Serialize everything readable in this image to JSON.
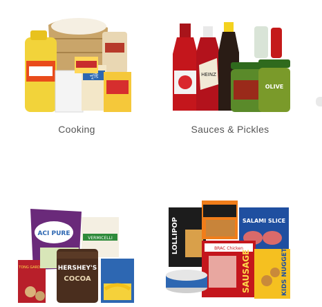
{
  "categories": [
    {
      "label": "Cooking",
      "image_icon": "cooking-products-image"
    },
    {
      "label": "Sauces & Pickles",
      "image_icon": "sauces-pickles-image"
    },
    {
      "label": "",
      "image_icon": "snacks-baking-image"
    },
    {
      "label": "",
      "image_icon": "frozen-foods-image"
    }
  ],
  "product_text": {
    "pusti": "পুষ্টি",
    "heinz": "HEINZ",
    "olive": "OLIVE",
    "aci_pure": "ACI PURE",
    "vermicelli": "VERMICELLI",
    "tong_garden": "TONG GARDEN",
    "hersheys": "HERSHEY'S",
    "cocoa": "COCOA",
    "lollipop": "LOLLIPOP",
    "brac_chicken": "BRAC Chicken",
    "salami": "SALAMI SLICE",
    "sausage": "SAUSAGE",
    "nuggets": "KIDS NUGGETS"
  },
  "colors": {
    "label_text": "#555555",
    "oil_yellow": "#f2d33a",
    "sauce_red": "#c4161c",
    "pickle_green": "#3d7a1e",
    "chips_purple": "#6a2a7a",
    "frozen_orange": "#f07d1a"
  }
}
